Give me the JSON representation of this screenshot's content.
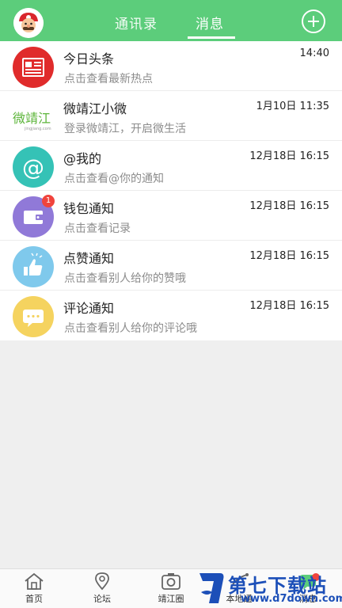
{
  "header": {
    "tabs": [
      {
        "label": "通讯录"
      },
      {
        "label": "消息"
      }
    ]
  },
  "messages": [
    {
      "title": "今日头条",
      "subtitle": "点击查看最新热点",
      "time": "14:40",
      "icon": "newspaper-icon",
      "color": "#e02b2b"
    },
    {
      "title": "微靖江小微",
      "subtitle": "登录微靖江，开启微生活",
      "time": "1月10日 11:35",
      "icon": "weijingjiang-logo-icon",
      "logo_text": "微靖江",
      "color": "#5cb53a"
    },
    {
      "title": "@我的",
      "subtitle": "点击查看@你的通知",
      "time": "12月18日 16:15",
      "icon": "at-icon",
      "color": "#35c2b6"
    },
    {
      "title": "钱包通知",
      "subtitle": "点击查看记录",
      "time": "12月18日 16:15",
      "icon": "wallet-icon",
      "badge": "1",
      "color": "#9079d8"
    },
    {
      "title": "点赞通知",
      "subtitle": "点击查看别人给你的赞哦",
      "time": "12月18日 16:15",
      "icon": "thumbs-up-icon",
      "color": "#7fc9ec"
    },
    {
      "title": "评论通知",
      "subtitle": "点击查看别人给你的评论哦",
      "time": "12月18日 16:15",
      "icon": "comment-icon",
      "color": "#f5d35f"
    }
  ],
  "bottom_nav": [
    {
      "label": "首页",
      "icon": "home-icon"
    },
    {
      "label": "论坛",
      "icon": "location-pin-icon"
    },
    {
      "label": "靖江圈",
      "icon": "camera-icon"
    },
    {
      "label": "本地通",
      "icon": "local-icon"
    },
    {
      "label": "消息",
      "icon": "message-icon"
    }
  ],
  "watermark": {
    "text": "第七下载站",
    "url": "www.d7down.com"
  }
}
